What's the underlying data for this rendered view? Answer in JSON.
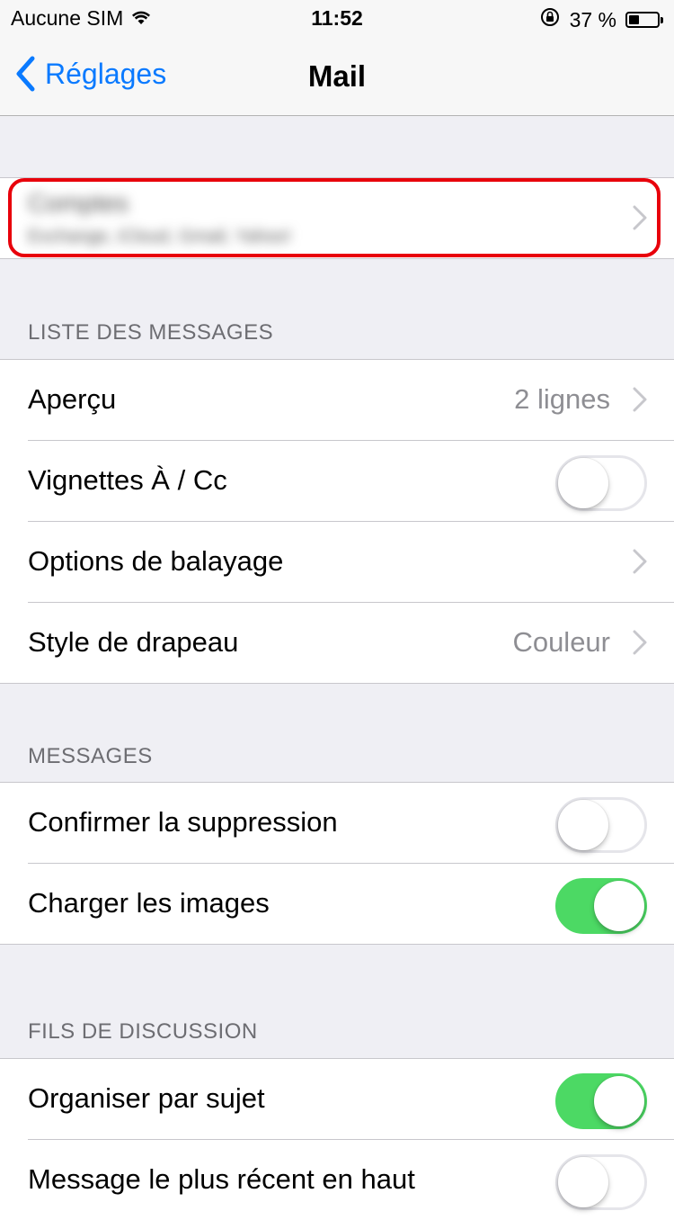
{
  "status": {
    "carrier": "Aucune SIM",
    "time": "11:52",
    "battery": "37 %",
    "battery_level": 0.37
  },
  "nav": {
    "back_label": "Réglages",
    "title": "Mail"
  },
  "accounts": {
    "title": "Comptes",
    "subtitle": "Exchange, iCloud, Gmail, Yahoo!"
  },
  "list_section": {
    "header": "LISTE DES MESSAGES",
    "preview_label": "Aperçu",
    "preview_value": "2 lignes",
    "thumbnails_label": "Vignettes À / Cc",
    "thumbnails_on": false,
    "swipe_label": "Options de balayage",
    "flag_label": "Style de drapeau",
    "flag_value": "Couleur"
  },
  "messages_section": {
    "header": "MESSAGES",
    "confirm_delete_label": "Confirmer la suppression",
    "confirm_delete_on": false,
    "load_images_label": "Charger les images",
    "load_images_on": true
  },
  "threads_section": {
    "header": "FILS DE DISCUSSION",
    "organize_label": "Organiser par sujet",
    "organize_on": true,
    "recent_top_label": "Message le plus récent en haut",
    "recent_top_on": false
  }
}
